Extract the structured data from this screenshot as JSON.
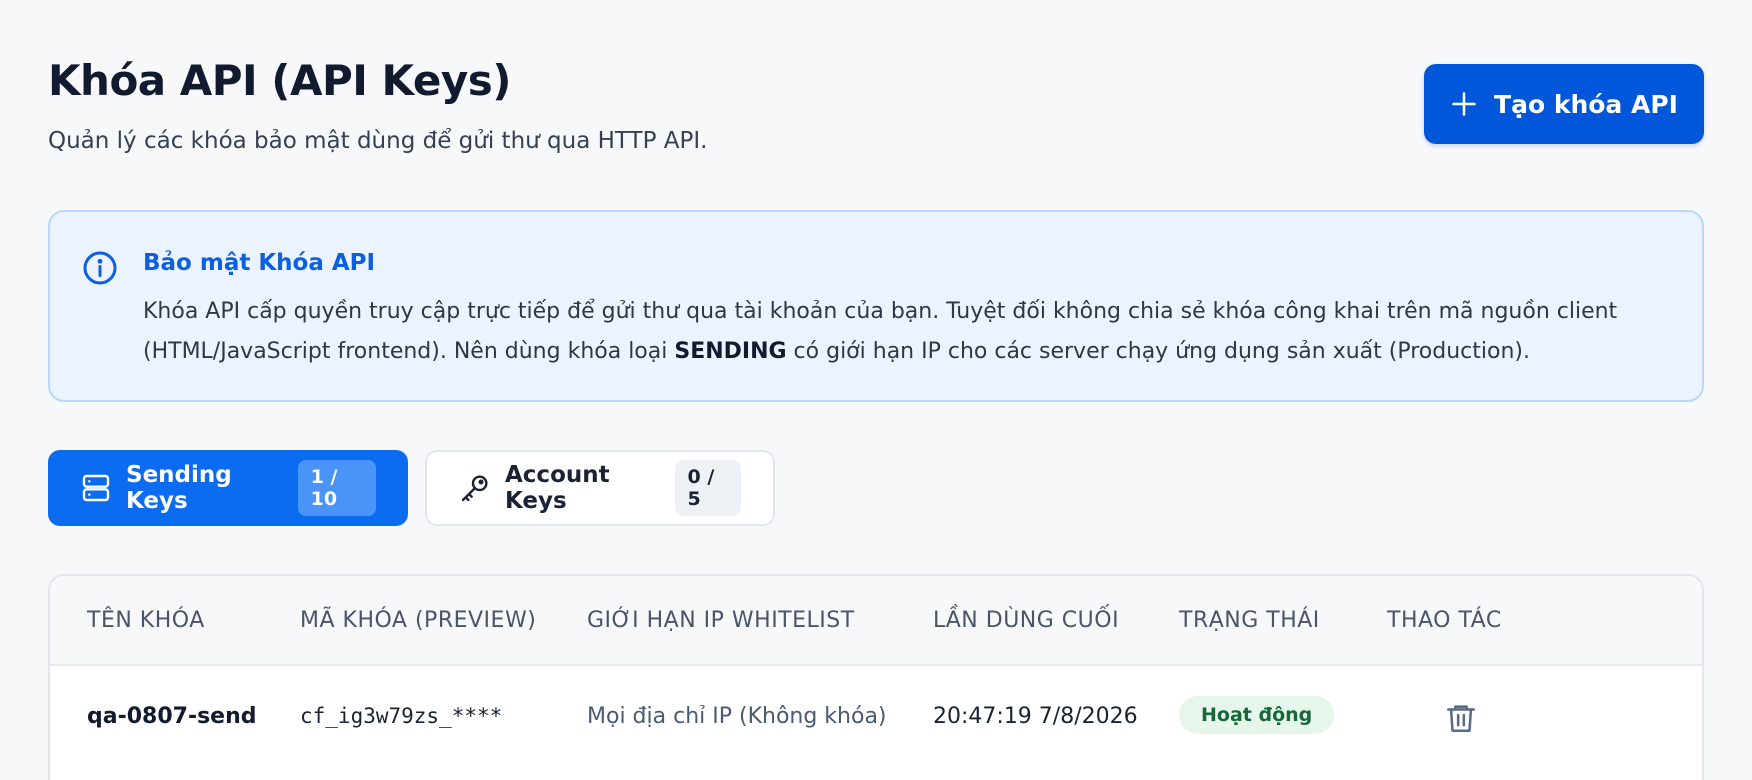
{
  "header": {
    "title": "Khóa API (API Keys)",
    "subtitle": "Quản lý các khóa bảo mật dùng để gửi thư qua HTTP API.",
    "create_button_label": "Tạo khóa API"
  },
  "info": {
    "title": "Bảo mật Khóa API",
    "body_part1": "Khóa API cấp quyền truy cập trực tiếp để gửi thư qua tài khoản của bạn. Tuyệt đối không chia sẻ khóa công khai trên mã nguồn client (HTML/JavaScript frontend). Nên dùng khóa loại ",
    "body_bold": "SENDING",
    "body_part2": " có giới hạn IP cho các server chạy ứng dụng sản xuất (Production)."
  },
  "tabs": [
    {
      "label": "Sending Keys",
      "count": "1 / 10",
      "icon": "server-icon",
      "active": true
    },
    {
      "label": "Account Keys",
      "count": "0 / 5",
      "icon": "key-icon",
      "active": false
    }
  ],
  "table": {
    "columns": [
      "TÊN KHÓA",
      "MÃ KHÓA (PREVIEW)",
      "GIỚI HẠN IP WHITELIST",
      "LẦN DÙNG CUỐI",
      "TRẠNG THÁI",
      "THAO TÁC"
    ],
    "rows": [
      {
        "name": "qa-0807-send",
        "preview": "cf_ig3w79zs_****",
        "ip": "Mọi địa chỉ IP (Không khóa)",
        "last_used": "20:47:19 7/8/2026",
        "status": "Hoạt động",
        "action_icon": "trash-icon"
      }
    ]
  },
  "colors": {
    "primary": "#0057d9",
    "tab_active": "#0b6cf2",
    "info_bg": "#ebf3fe",
    "info_title": "#0c5fe0",
    "status_bg": "#e6f6ea",
    "status_text": "#16673a"
  }
}
